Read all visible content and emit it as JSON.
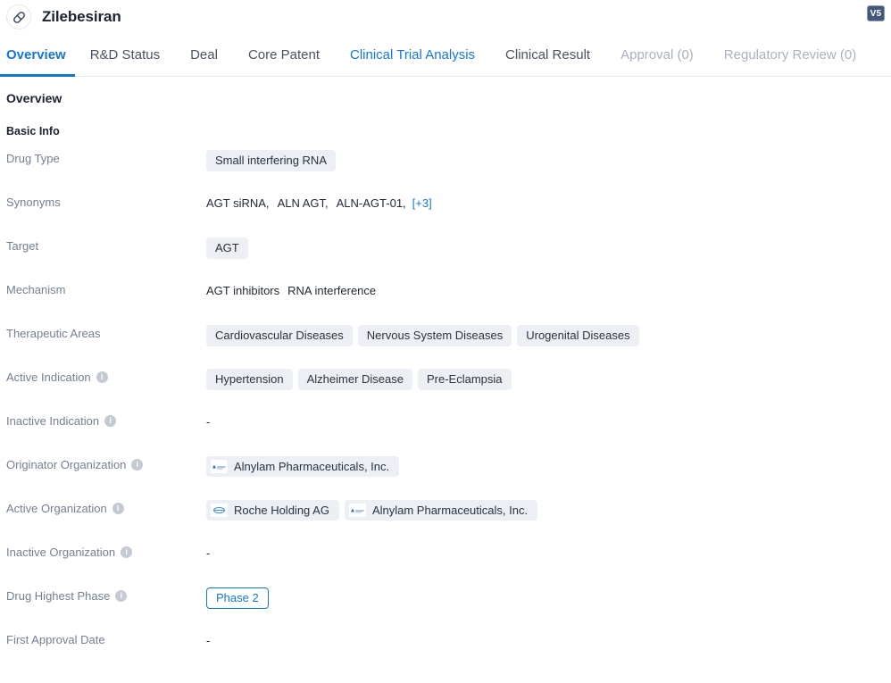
{
  "header": {
    "drug_name": "Zilebesiran",
    "avatar_icon": "capsule-pill-icon",
    "version_badge": "V5"
  },
  "tabs": [
    {
      "label": "Overview",
      "state": "active"
    },
    {
      "label": "R&D Status",
      "state": "default"
    },
    {
      "label": "Deal",
      "state": "default"
    },
    {
      "label": "Core Patent",
      "state": "default"
    },
    {
      "label": "Clinical Trial Analysis",
      "state": "link"
    },
    {
      "label": "Clinical Result",
      "state": "default"
    },
    {
      "label": "Approval (0)",
      "state": "muted"
    },
    {
      "label": "Regulatory Review (0)",
      "state": "muted"
    }
  ],
  "overview": {
    "section_title": "Overview",
    "subsection_title": "Basic Info",
    "fields": [
      {
        "label": "Drug Type",
        "has_info": false,
        "type": "tags",
        "values": [
          "Small interfering RNA"
        ]
      },
      {
        "label": "Synonyms",
        "has_info": false,
        "type": "synonyms",
        "values": [
          "AGT siRNA,",
          "ALN AGT,",
          "ALN-AGT-01,"
        ],
        "more": "[+3]"
      },
      {
        "label": "Target",
        "has_info": false,
        "type": "tags",
        "values": [
          "AGT"
        ]
      },
      {
        "label": "Mechanism",
        "has_info": false,
        "type": "text",
        "values": [
          "AGT inhibitors",
          "RNA interference"
        ]
      },
      {
        "label": "Therapeutic Areas",
        "has_info": false,
        "type": "tags",
        "values": [
          "Cardiovascular Diseases",
          "Nervous System Diseases",
          "Urogenital Diseases"
        ]
      },
      {
        "label": "Active Indication",
        "has_info": true,
        "type": "tags",
        "values": [
          "Hypertension",
          "Alzheimer Disease",
          "Pre-Eclampsia"
        ]
      },
      {
        "label": "Inactive Indication",
        "has_info": true,
        "type": "empty",
        "values": [
          "-"
        ]
      },
      {
        "label": "Originator Organization",
        "has_info": true,
        "type": "orgs",
        "orgs": [
          {
            "name": "Alnylam Pharmaceuticals, Inc.",
            "logo": "alnylam-logo"
          }
        ]
      },
      {
        "label": "Active Organization",
        "has_info": true,
        "type": "orgs",
        "orgs": [
          {
            "name": "Roche Holding AG",
            "logo": "roche-logo"
          },
          {
            "name": "Alnylam Pharmaceuticals, Inc.",
            "logo": "alnylam-logo"
          }
        ]
      },
      {
        "label": "Inactive Organization",
        "has_info": true,
        "type": "empty",
        "values": [
          "-"
        ]
      },
      {
        "label": "Drug Highest Phase",
        "has_info": true,
        "type": "phase",
        "values": [
          "Phase 2"
        ]
      },
      {
        "label": "First Approval Date",
        "has_info": false,
        "type": "empty",
        "values": [
          "-"
        ]
      }
    ]
  },
  "colors": {
    "accent": "#1677d2",
    "tag_bg": "#eceff3",
    "label_text": "#737f93",
    "value_text": "#232a36",
    "muted_tab": "#aab1bc",
    "badge_bg": "#46587a"
  }
}
